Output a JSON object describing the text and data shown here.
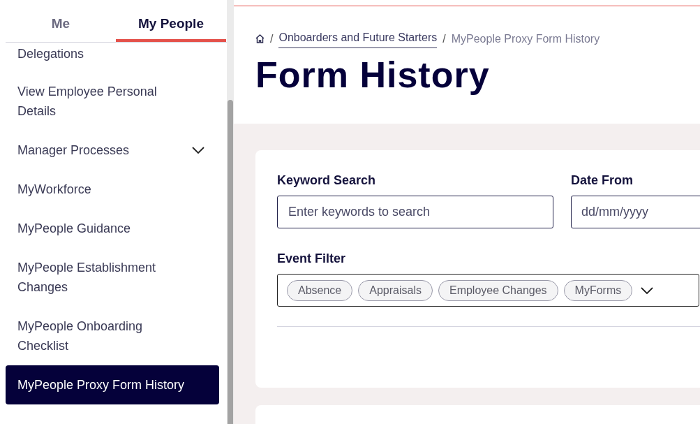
{
  "sidebar": {
    "tabs": [
      {
        "label": "Me",
        "selected": false
      },
      {
        "label": "My People",
        "selected": true
      }
    ],
    "items": [
      {
        "label": "Delegations",
        "kind": "link",
        "selected": false
      },
      {
        "label": "View Employee Personal Details",
        "kind": "link",
        "selected": false
      },
      {
        "label": "Manager Processes",
        "kind": "group",
        "selected": false
      },
      {
        "label": "MyWorkforce",
        "kind": "link",
        "selected": false
      },
      {
        "label": "MyPeople Guidance",
        "kind": "link",
        "selected": false
      },
      {
        "label": "MyPeople Establishment Changes",
        "kind": "link",
        "selected": false
      },
      {
        "label": "MyPeople Onboarding Checklist",
        "kind": "link",
        "selected": false
      },
      {
        "label": "MyPeople Proxy Form History",
        "kind": "link",
        "selected": true
      }
    ]
  },
  "breadcrumb": {
    "separator": "/",
    "links": [
      "Onboarders and Future Starters"
    ],
    "current": "MyPeople Proxy Form History"
  },
  "page_title": "Form History",
  "filters": {
    "keyword": {
      "label": "Keyword Search",
      "placeholder": "Enter keywords to search"
    },
    "date_from": {
      "label": "Date From",
      "placeholder": "dd/mm/yyyy"
    },
    "event_filter": {
      "label": "Event Filter",
      "chips": [
        "Absence",
        "Appraisals",
        "Employee Changes",
        "MyForms"
      ]
    }
  }
}
